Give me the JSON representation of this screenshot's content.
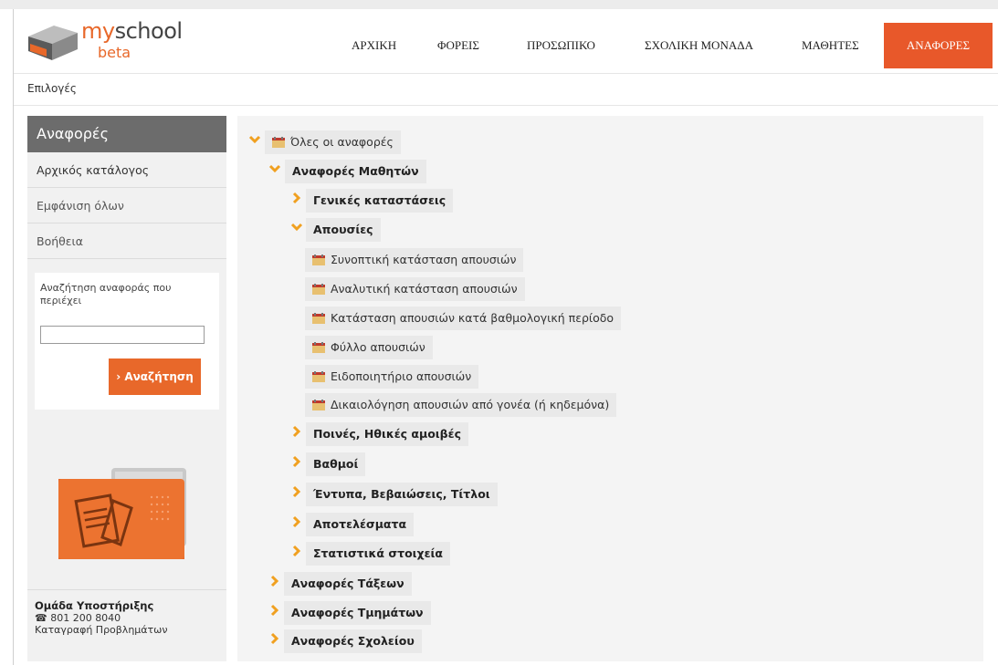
{
  "header": {
    "logo_my": "my",
    "logo_school": "school",
    "logo_beta": "beta",
    "nav": [
      {
        "label": "ΑΡΧΙΚΗ",
        "active": false
      },
      {
        "label": "ΦΟΡΕΙΣ",
        "active": false
      },
      {
        "label": "ΠΡΟΣΩΠΙΚΟ",
        "active": false
      },
      {
        "label": "ΣΧΟΛΙΚΗ ΜΟΝΑΔΑ",
        "active": false
      },
      {
        "label": "ΜΑΘΗΤΕΣ",
        "active": false
      },
      {
        "label": "ΑΝΑΦΟΡΕΣ",
        "active": true
      }
    ]
  },
  "subbar": {
    "label": "Επιλογές"
  },
  "sidebar": {
    "title": "Αναφορές",
    "items": [
      "Αρχικός κατάλογος",
      "Εμφάνιση όλων",
      "Βοήθεια"
    ],
    "search_label": "Αναζήτηση αναφοράς που περιέχει",
    "search_value": "",
    "search_button": "Αναζήτηση",
    "support_title": "Ομάδα Υποστήριξης",
    "support_phone": "801 200 8040",
    "support_link": "Καταγραφή Προβλημάτων"
  },
  "tree": [
    {
      "label": "Όλες οι αναφορές",
      "icon": "calendar-icon",
      "arrow": "expanded"
    },
    {
      "label": "Αναφορές Μαθητών",
      "arrow": "expanded"
    },
    {
      "label": "Γενικές καταστάσεις",
      "arrow": "collapsed"
    },
    {
      "label": "Απουσίες",
      "arrow": "expanded"
    },
    {
      "label": "Συνοπτική κατάσταση απουσιών",
      "icon": "calendar-icon"
    },
    {
      "label": "Αναλυτική κατάσταση απουσιών",
      "icon": "calendar-icon"
    },
    {
      "label": "Κατάσταση απουσιών κατά βαθμολογική περίοδο",
      "icon": "calendar-icon"
    },
    {
      "label": "Φύλλο απουσιών",
      "icon": "calendar-icon"
    },
    {
      "label": "Ειδοποιητήριο απουσιών",
      "icon": "calendar-icon"
    },
    {
      "label": "Δικαιολόγηση απουσιών από γονέα (ή κηδεμόνα)",
      "icon": "calendar-icon"
    },
    {
      "label": "Ποινές, Ηθικές αμοιβές",
      "arrow": "collapsed"
    },
    {
      "label": "Βαθμοί",
      "arrow": "collapsed"
    },
    {
      "label": "Έντυπα, Βεβαιώσεις, Τίτλοι",
      "arrow": "collapsed"
    },
    {
      "label": "Αποτελέσματα",
      "arrow": "collapsed"
    },
    {
      "label": "Στατιστικά στοιχεία",
      "arrow": "collapsed"
    },
    {
      "label": "Αναφορές Τάξεων",
      "arrow": "collapsed"
    },
    {
      "label": "Αναφορές Τμημάτων",
      "arrow": "collapsed"
    },
    {
      "label": "Αναφορές Σχολείου",
      "arrow": "collapsed"
    }
  ],
  "colors": {
    "accent": "#e8582a",
    "sidebar_head": "#6c6c6c",
    "arrow": "#f0a020"
  }
}
